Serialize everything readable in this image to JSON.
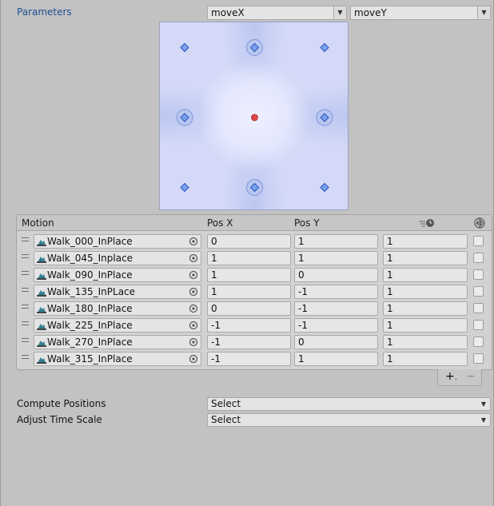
{
  "parameters": {
    "label": "Parameters",
    "param_x": "moveX",
    "param_y": "moveY"
  },
  "blend_tree_area": {
    "motion_points": [
      {
        "x": -1,
        "y": 1
      },
      {
        "x": 0,
        "y": 1
      },
      {
        "x": 1,
        "y": 1
      },
      {
        "x": -1,
        "y": 0
      },
      {
        "x": 1,
        "y": 0
      },
      {
        "x": -1,
        "y": -1
      },
      {
        "x": 0,
        "y": -1
      },
      {
        "x": 1,
        "y": -1
      }
    ],
    "current_position": {
      "x": 0,
      "y": 0
    },
    "colors": {
      "motion_fill": "#7aa0f0",
      "motion_stroke": "#2b55b8",
      "ring_fill": "#b4c4ee",
      "ring_stroke": "#7e95d8",
      "current_fill": "#e04848"
    }
  },
  "motion_table": {
    "headers": {
      "motion": "Motion",
      "pos_x": "Pos X",
      "pos_y": "Pos Y"
    },
    "header_icons": [
      "time-scale-icon",
      "mirror-icon"
    ],
    "rows": [
      {
        "clip": "Walk_000_InPlace",
        "pos_x": "0",
        "pos_y": "1",
        "time_scale": "1"
      },
      {
        "clip": "Walk_045_Inplace",
        "pos_x": "1",
        "pos_y": "1",
        "time_scale": "1"
      },
      {
        "clip": "Walk_090_InPlace",
        "pos_x": "1",
        "pos_y": "0",
        "time_scale": "1"
      },
      {
        "clip": "Walk_135_InPLace",
        "pos_x": "1",
        "pos_y": "-1",
        "time_scale": "1"
      },
      {
        "clip": "Walk_180_InPlace",
        "pos_x": "0",
        "pos_y": "-1",
        "time_scale": "1"
      },
      {
        "clip": "Walk_225_InPlace",
        "pos_x": "-1",
        "pos_y": "-1",
        "time_scale": "1"
      },
      {
        "clip": "Walk_270_InPlace",
        "pos_x": "-1",
        "pos_y": "0",
        "time_scale": "1"
      },
      {
        "clip": "Walk_315_InPlace",
        "pos_x": "-1",
        "pos_y": "1",
        "time_scale": "1"
      }
    ],
    "add_label": "+",
    "add_dropdown_label": ".",
    "remove_label": "−"
  },
  "settings": {
    "compute_positions": {
      "label": "Compute Positions",
      "value": "Select"
    },
    "adjust_time_scale": {
      "label": "Adjust Time Scale",
      "value": "Select"
    }
  },
  "dropdown_arrow": "▼"
}
